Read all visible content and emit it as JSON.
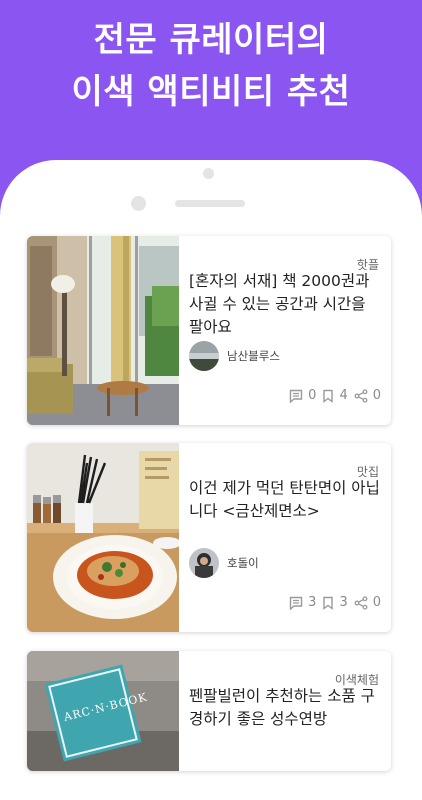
{
  "headline": {
    "line1": "전문 큐레이터의",
    "line2": "이색 액티비티 추천"
  },
  "colors": {
    "background": "#8b55f2",
    "card": "#ffffff",
    "text": "#222222",
    "muted": "#8a8a8a"
  },
  "posts": [
    {
      "category": "핫플",
      "title": "[혼자의 서재] 책 2000권과 사귈 수 있는 공간과 시간을 팔아요",
      "author": "남산블루스",
      "comments": "0",
      "bookmarks": "4",
      "shares": "0"
    },
    {
      "category": "맛집",
      "title": "이건 제가 먹던 탄탄면이 아닙니다 <금산제면소>",
      "author": "호돌이",
      "comments": "3",
      "bookmarks": "3",
      "shares": "0"
    },
    {
      "category": "이색체험",
      "title": "펜팔빌런이 추천하는 소품 구경하기 좋은 성수연방",
      "sign_text": "ARC·N·BOOK"
    }
  ]
}
